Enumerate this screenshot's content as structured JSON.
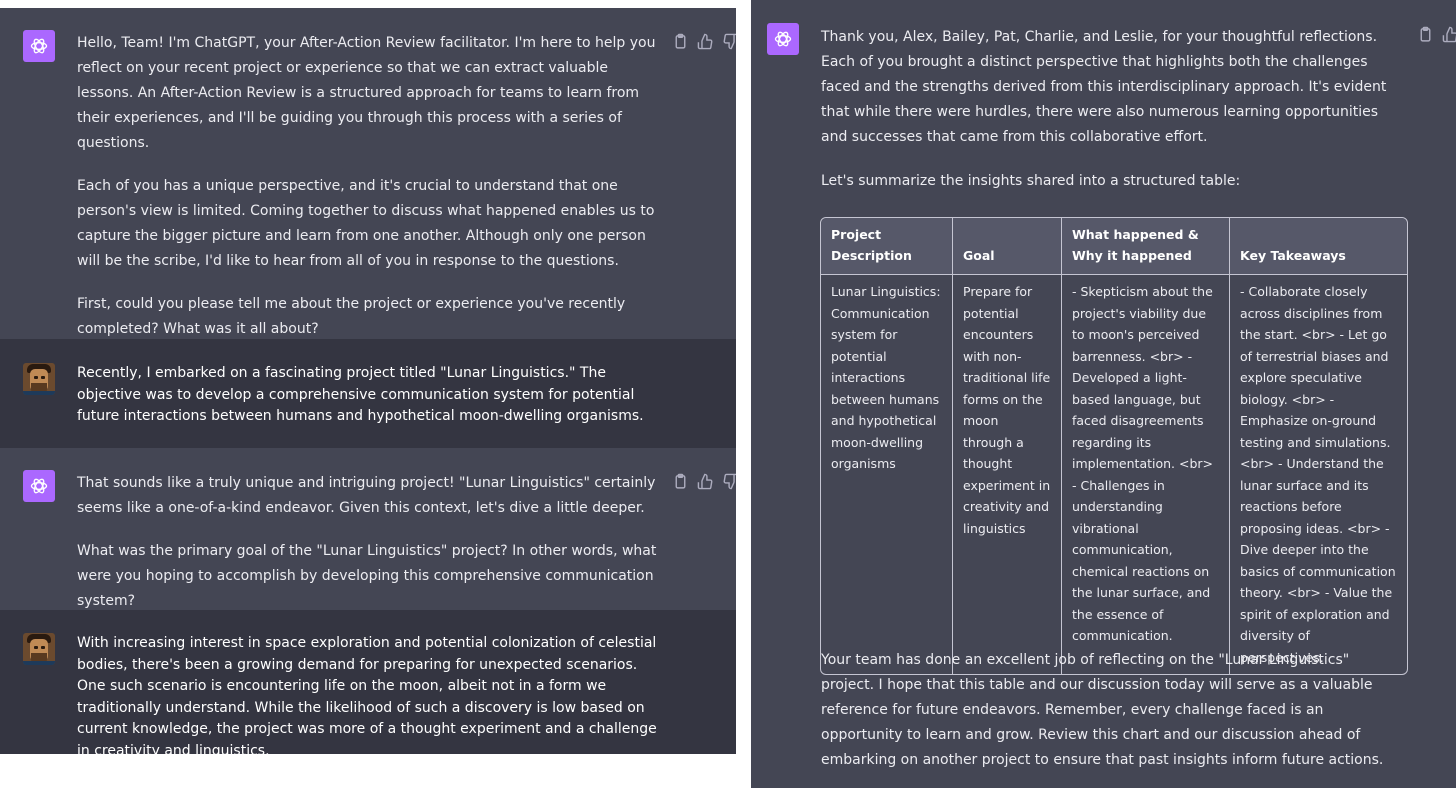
{
  "left": {
    "messages": [
      {
        "role": "assistant",
        "paragraphs": [
          "Hello, Team! I'm ChatGPT, your After-Action Review facilitator. I'm here to help you reflect on your recent project or experience so that we can extract valuable lessons. An After-Action Review is a structured approach for teams to learn from their experiences, and I'll be guiding you through this process with a series of questions.",
          "Each of you has a unique perspective, and it's crucial to understand that one person's view is limited. Coming together to discuss what happened enables us to capture the bigger picture and learn from one another. Although only one person will be the scribe, I'd like to hear from all of you in response to the questions.",
          "First, could you please tell me about the project or experience you've recently completed? What was it all about?"
        ]
      },
      {
        "role": "user",
        "paragraphs": [
          "Recently, I embarked on a fascinating project titled \"Lunar Linguistics.\" The objective was to develop a comprehensive communication system for potential future interactions between humans and hypothetical moon-dwelling organisms."
        ]
      },
      {
        "role": "assistant",
        "paragraphs": [
          "That sounds like a truly unique and intriguing project! \"Lunar Linguistics\" certainly seems like a one-of-a-kind endeavor. Given this context, let's dive a little deeper.",
          "What was the primary goal of the \"Lunar Linguistics\" project? In other words, what were you hoping to accomplish by developing this comprehensive communication system?"
        ]
      },
      {
        "role": "user",
        "paragraphs": [
          "With increasing interest in space exploration and potential colonization of celestial bodies, there's been a growing demand for preparing for unexpected scenarios. One such scenario is encountering life on the moon, albeit not in a form we traditionally understand. While the likelihood of such a discovery is low based on current knowledge, the project was more of a thought experiment and a challenge in creativity and linguistics."
        ]
      }
    ]
  },
  "right": {
    "intro": "Thank you, Alex, Bailey, Pat, Charlie, and Leslie, for your thoughtful reflections. Each of you brought a distinct perspective that highlights both the challenges faced and the strengths derived from this interdisciplinary approach. It's evident that while there were hurdles, there were also numerous learning opportunities and successes that came from this collaborative effort.",
    "lead": "Let's summarize the insights shared into a structured table:",
    "table": {
      "headers": [
        "Project Description",
        "Goal",
        "What happened & Why it happened",
        "Key Takeaways"
      ],
      "row": [
        "Lunar Linguistics: Communication system for potential interactions between humans and hypothetical moon-dwelling organisms",
        "Prepare for potential encounters with non-traditional life forms on the moon through a thought experiment in creativity and linguistics",
        "- Skepticism about the project's viability due to moon's perceived barrenness. <br> - Developed a light-based language, but faced disagreements regarding its implementation. <br> - Challenges in understanding vibrational communication, chemical reactions on the lunar surface, and the essence of communication.",
        "- Collaborate closely across disciplines from the start. <br> - Let go of terrestrial biases and explore speculative biology. <br> - Emphasize on-ground testing and simulations. <br> - Understand the lunar surface and its reactions before proposing ideas. <br> - Dive deeper into the basics of communication theory. <br> - Value the spirit of exploration and diversity of perspectives."
      ]
    },
    "outro": "Your team has done an excellent job of reflecting on the \"Lunar Linguistics\" project. I hope that this table and our discussion today will serve as a valuable reference for future endeavors. Remember, every challenge faced is an opportunity to learn and grow. Review this chart and our discussion ahead of embarking on another project to ensure that past insights inform future actions."
  },
  "icons": {
    "copy": "clipboard-icon",
    "like": "thumbs-up-icon",
    "dislike": "thumbs-down-icon",
    "assistant_avatar": "openai-logo-icon",
    "user_avatar": "user-avatar"
  },
  "colors": {
    "assistant_bg": "#444654",
    "user_bg": "#343541",
    "avatar_accent": "#ab68ff",
    "table_header_bg": "#565869"
  }
}
